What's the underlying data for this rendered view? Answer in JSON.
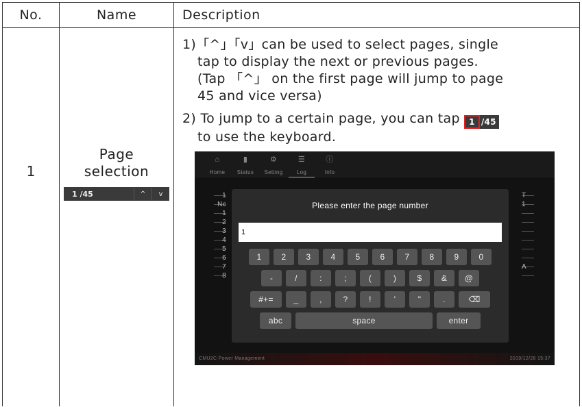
{
  "table": {
    "headers": {
      "no": "No.",
      "name": "Name",
      "description": "Description"
    },
    "row": {
      "no": "1",
      "name_line1": "Page",
      "name_line2": "selection",
      "pager": {
        "value": "1 /45",
        "up": "^",
        "down": "v"
      }
    }
  },
  "description": {
    "item1": {
      "line1": "1)「^」「v」can be used to select pages, single",
      "line2": "tap to display the next or previous pages.",
      "line3": "(Tap 「^」 on the first page will jump to page",
      "line4": "45 and vice versa)"
    },
    "item2": {
      "line1": "2) To jump to a certain page, you can tap",
      "pager_current": "1",
      "pager_total": "/45",
      "line2": "to use the keyboard."
    }
  },
  "screenshot": {
    "tabs": [
      {
        "label": "Home",
        "icon": "home-icon"
      },
      {
        "label": "Status",
        "icon": "bar-chart-icon"
      },
      {
        "label": "Setting",
        "icon": "gear-icon"
      },
      {
        "label": "Log",
        "icon": "log-icon"
      },
      {
        "label": "Info",
        "icon": "info-icon"
      }
    ],
    "left_rows": [
      "1",
      "Nc",
      "1",
      "2",
      "3",
      "4",
      "5",
      "6",
      "7",
      "8"
    ],
    "right_rows": [
      "T",
      "1",
      "",
      "",
      "",
      "",
      "",
      "",
      "A",
      ""
    ],
    "dialog": {
      "title": "Please enter the page number",
      "input_value": "1",
      "row1": [
        "1",
        "2",
        "3",
        "4",
        "5",
        "6",
        "7",
        "8",
        "9",
        "0"
      ],
      "row2": [
        "-",
        "/",
        ":",
        ";",
        "(",
        ")",
        "$",
        "&",
        "@"
      ],
      "row3": {
        "shift": "#+=",
        "keys": [
          "_",
          ",",
          "?",
          "!",
          "'",
          "\""
        ],
        "dot": ".",
        "backspace": "⌫"
      },
      "row4": {
        "abc": "abc",
        "space": "space",
        "enter": "enter"
      }
    },
    "footer": {
      "left": "CMU2C Power Management",
      "right": "2019/12/26 15:37"
    }
  }
}
